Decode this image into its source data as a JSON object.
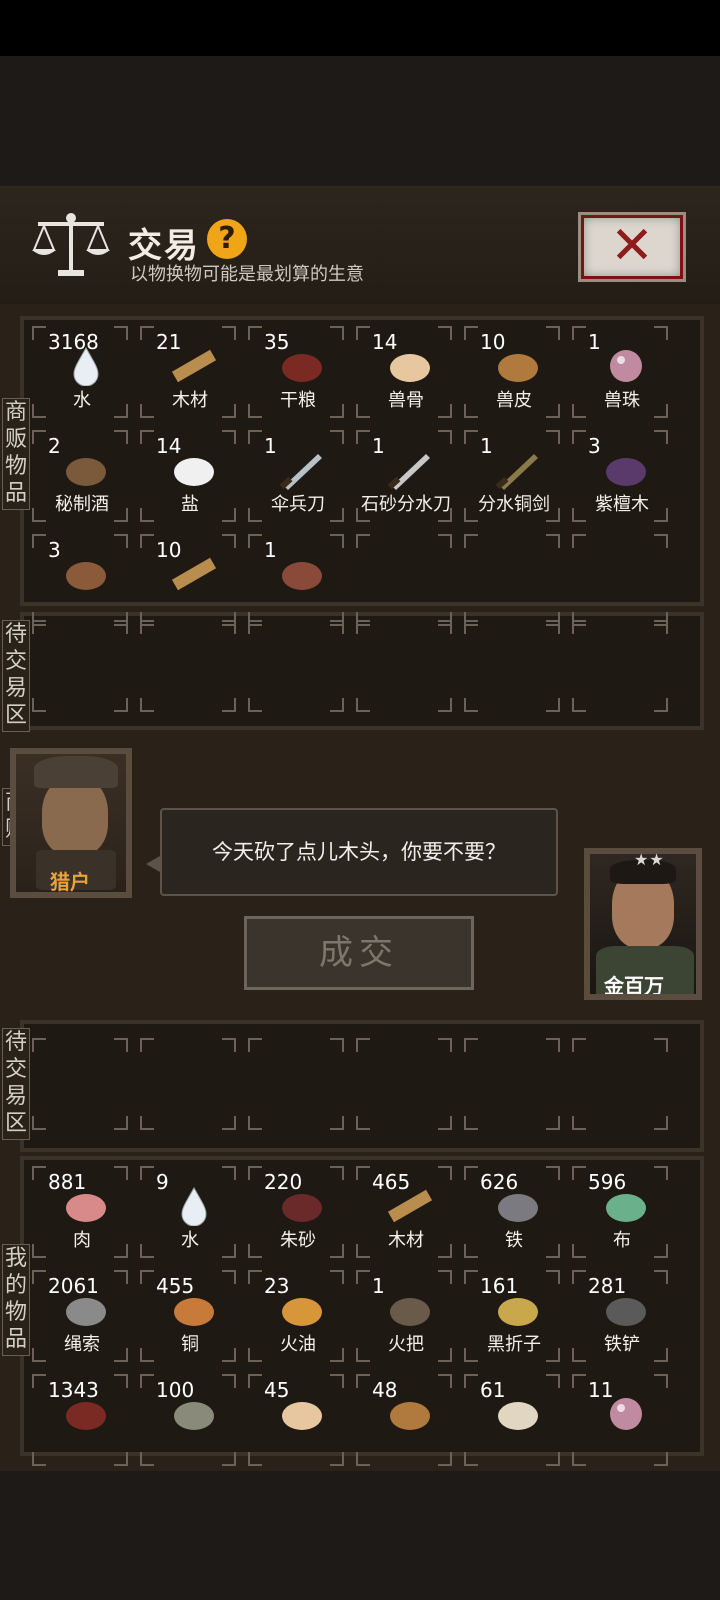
{
  "header": {
    "title": "交易",
    "help_icon": "?",
    "subtitle": "以物换物可能是最划算的生意"
  },
  "side_labels": {
    "merchant_items": "商贩物品",
    "pending_top": "待交易区",
    "merchant": "商贩",
    "pending_bottom": "待交易区",
    "my_items": "我的物品"
  },
  "merchant_items": [
    {
      "count": "3168",
      "label": "水",
      "icon": "water-drop-icon"
    },
    {
      "count": "21",
      "label": "木材",
      "icon": "wood-plank-icon"
    },
    {
      "count": "35",
      "label": "干粮",
      "icon": "dried-meat-icon"
    },
    {
      "count": "14",
      "label": "兽骨",
      "icon": "beast-bone-icon"
    },
    {
      "count": "10",
      "label": "兽皮",
      "icon": "beast-hide-icon"
    },
    {
      "count": "1",
      "label": "兽珠",
      "icon": "beast-pearl-icon"
    },
    {
      "count": "2",
      "label": "秘制酒",
      "icon": "wine-jar-icon"
    },
    {
      "count": "14",
      "label": "盐",
      "icon": "salt-pile-icon"
    },
    {
      "count": "1",
      "label": "伞兵刀",
      "icon": "paratrooper-knife-icon"
    },
    {
      "count": "1",
      "label": "石砂分水刀",
      "icon": "knife-icon"
    },
    {
      "count": "1",
      "label": "分水铜剑",
      "icon": "bronze-sword-icon"
    },
    {
      "count": "3",
      "label": "紫檀木",
      "icon": "rosewood-icon"
    },
    {
      "count": "3",
      "label": "",
      "icon": "branch-icon"
    },
    {
      "count": "10",
      "label": "",
      "icon": "wood-plank-icon"
    },
    {
      "count": "1",
      "label": "",
      "icon": "arrows-icon"
    }
  ],
  "merchant": {
    "name": "猎户",
    "speech": "今天砍了点儿木头，你要不要？"
  },
  "deal_button": "成交",
  "player": {
    "name": "金百万",
    "stars": "★★"
  },
  "my_items": [
    {
      "count": "881",
      "label": "肉",
      "icon": "meat-icon"
    },
    {
      "count": "9",
      "label": "水",
      "icon": "water-drop-icon"
    },
    {
      "count": "220",
      "label": "朱砂",
      "icon": "cinnabar-icon"
    },
    {
      "count": "465",
      "label": "木材",
      "icon": "wood-plank-icon"
    },
    {
      "count": "626",
      "label": "铁",
      "icon": "iron-ore-icon"
    },
    {
      "count": "596",
      "label": "布",
      "icon": "cloth-icon"
    },
    {
      "count": "2061",
      "label": "绳索",
      "icon": "rope-icon"
    },
    {
      "count": "455",
      "label": "铜",
      "icon": "copper-ore-icon"
    },
    {
      "count": "23",
      "label": "火油",
      "icon": "oil-bottle-icon"
    },
    {
      "count": "1",
      "label": "火把",
      "icon": "torch-icon"
    },
    {
      "count": "161",
      "label": "黑折子",
      "icon": "pickaxe-icon"
    },
    {
      "count": "281",
      "label": "铁铲",
      "icon": "shovel-icon"
    },
    {
      "count": "1343",
      "label": "",
      "icon": "dried-meat-icon"
    },
    {
      "count": "100",
      "label": "",
      "icon": "gourd-icon"
    },
    {
      "count": "45",
      "label": "",
      "icon": "beast-bone-icon"
    },
    {
      "count": "48",
      "label": "",
      "icon": "beast-hide-icon"
    },
    {
      "count": "61",
      "label": "",
      "icon": "fang-icon"
    },
    {
      "count": "11",
      "label": "",
      "icon": "beast-pearl-icon"
    }
  ]
}
